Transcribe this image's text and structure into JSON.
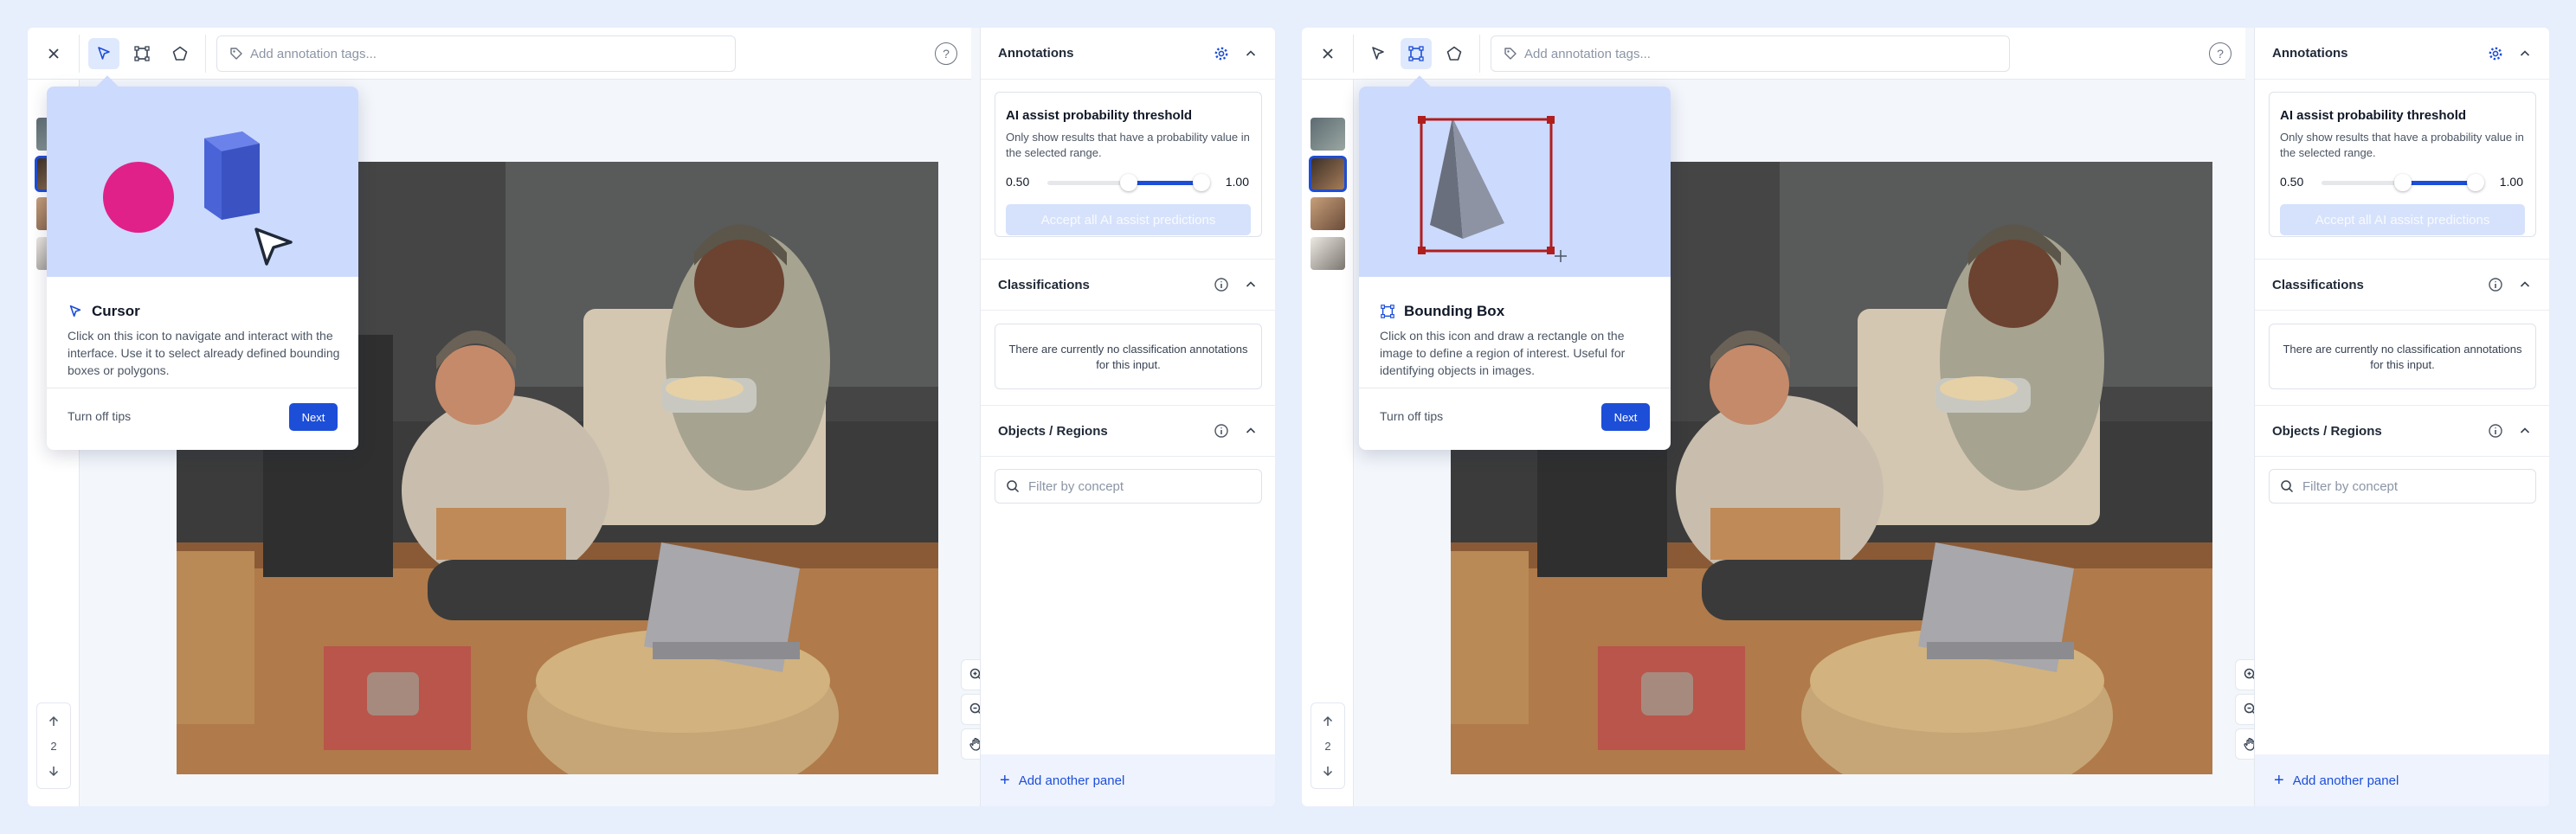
{
  "colors": {
    "accent": "#1d4ed8",
    "background": "#e7eefc",
    "tip_illustration": "#ccdafd"
  },
  "screens": [
    {
      "toolbar": {
        "close_icon": "close-icon",
        "tools": [
          "cursor-tool",
          "bounding-box-tool",
          "polygon-tool"
        ],
        "active_tool": "cursor-tool",
        "tags_placeholder": "Add annotation tags...",
        "help": "?"
      },
      "pager": {
        "page": "2"
      },
      "tip": {
        "title": "Cursor",
        "body": "Click on this icon to navigate and interact with the interface. Use it to select already defined bounding boxes or polygons.",
        "turn_off": "Turn off tips",
        "next": "Next"
      },
      "panel": {
        "annotations_title": "Annotations",
        "ai_title": "AI assist probability threshold",
        "ai_desc": "Only show results that have a probability value in the selected range.",
        "range_low": "0.50",
        "range_high": "1.00",
        "accept_label": "Accept all AI assist predictions",
        "classifications_title": "Classifications",
        "no_classifications": "There are currently no classification annotations for this input.",
        "objects_title": "Objects / Regions",
        "filter_placeholder": "Filter by concept",
        "add_panel": "Add another panel"
      }
    },
    {
      "toolbar": {
        "close_icon": "close-icon",
        "tools": [
          "cursor-tool",
          "bounding-box-tool",
          "polygon-tool"
        ],
        "active_tool": "bounding-box-tool",
        "tags_placeholder": "Add annotation tags...",
        "help": "?"
      },
      "pager": {
        "page": "2"
      },
      "tip": {
        "title": "Bounding Box",
        "body": "Click on this icon and draw a rectangle on the image to define a region of interest. Useful for identifying objects in images.",
        "turn_off": "Turn off tips",
        "next": "Next"
      },
      "panel": {
        "annotations_title": "Annotations",
        "ai_title": "AI assist probability threshold",
        "ai_desc": "Only show results that have a probability value in the selected range.",
        "range_low": "0.50",
        "range_high": "1.00",
        "accept_label": "Accept all AI assist predictions",
        "classifications_title": "Classifications",
        "no_classifications": "There are currently no classification annotations for this input.",
        "objects_title": "Objects / Regions",
        "filter_placeholder": "Filter by concept",
        "add_panel": "Add another panel"
      }
    }
  ]
}
